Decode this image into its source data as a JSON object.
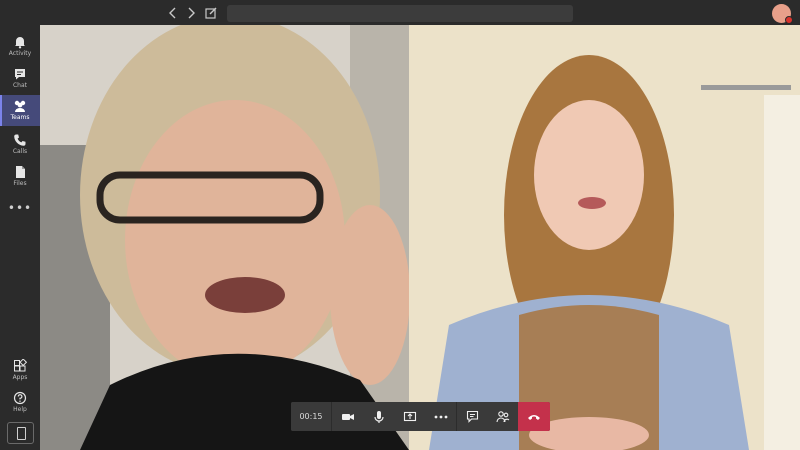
{
  "topbar": {
    "search_placeholder": "",
    "nav": {
      "back_icon": "chevron-left",
      "forward_icon": "chevron-right",
      "compose_icon": "compose"
    }
  },
  "rail": {
    "items": [
      {
        "label": "Activity",
        "icon": "bell"
      },
      {
        "label": "Chat",
        "icon": "chat-bubble"
      },
      {
        "label": "Teams",
        "icon": "teams",
        "active": true
      },
      {
        "label": "Calls",
        "icon": "phone"
      },
      {
        "label": "Files",
        "icon": "file"
      }
    ],
    "more_glyph": "•••",
    "bottom": [
      {
        "label": "Apps",
        "icon": "apps"
      },
      {
        "label": "Help",
        "icon": "help"
      }
    ]
  },
  "call": {
    "timer": "00:15",
    "controls": [
      "camera",
      "microphone",
      "share-screen",
      "more",
      "chat",
      "participants",
      "hang-up"
    ]
  },
  "colors": {
    "accent": "#7b83eb",
    "active_rail": "#454a7a",
    "hangup": "#c4314b",
    "chrome": "#2b2b2b",
    "notification": "#d9322c"
  }
}
